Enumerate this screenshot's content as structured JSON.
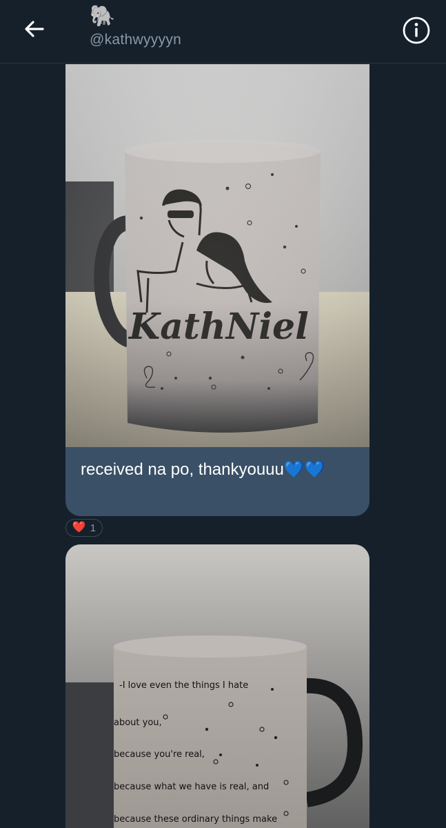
{
  "header": {
    "avatar_emoji": "🐘",
    "handle": "@kathwyyyyn"
  },
  "messages": [
    {
      "image_lettering": "KathNiel",
      "caption": "received na po, thankyouuu💙💙",
      "reaction": {
        "emoji": "❤️",
        "count": "1"
      }
    },
    {
      "image_lettering": [
        "I love even the things I hate",
        "about you,",
        "because you're real,",
        "because what we have is real, and",
        "because these ordinary things make"
      ]
    }
  ],
  "colors": {
    "background": "#15202b",
    "bubble": "#3a5066",
    "reaction_heart": "#e0245e"
  },
  "icons": [
    "back-arrow-icon",
    "info-icon",
    "heart-icon"
  ]
}
